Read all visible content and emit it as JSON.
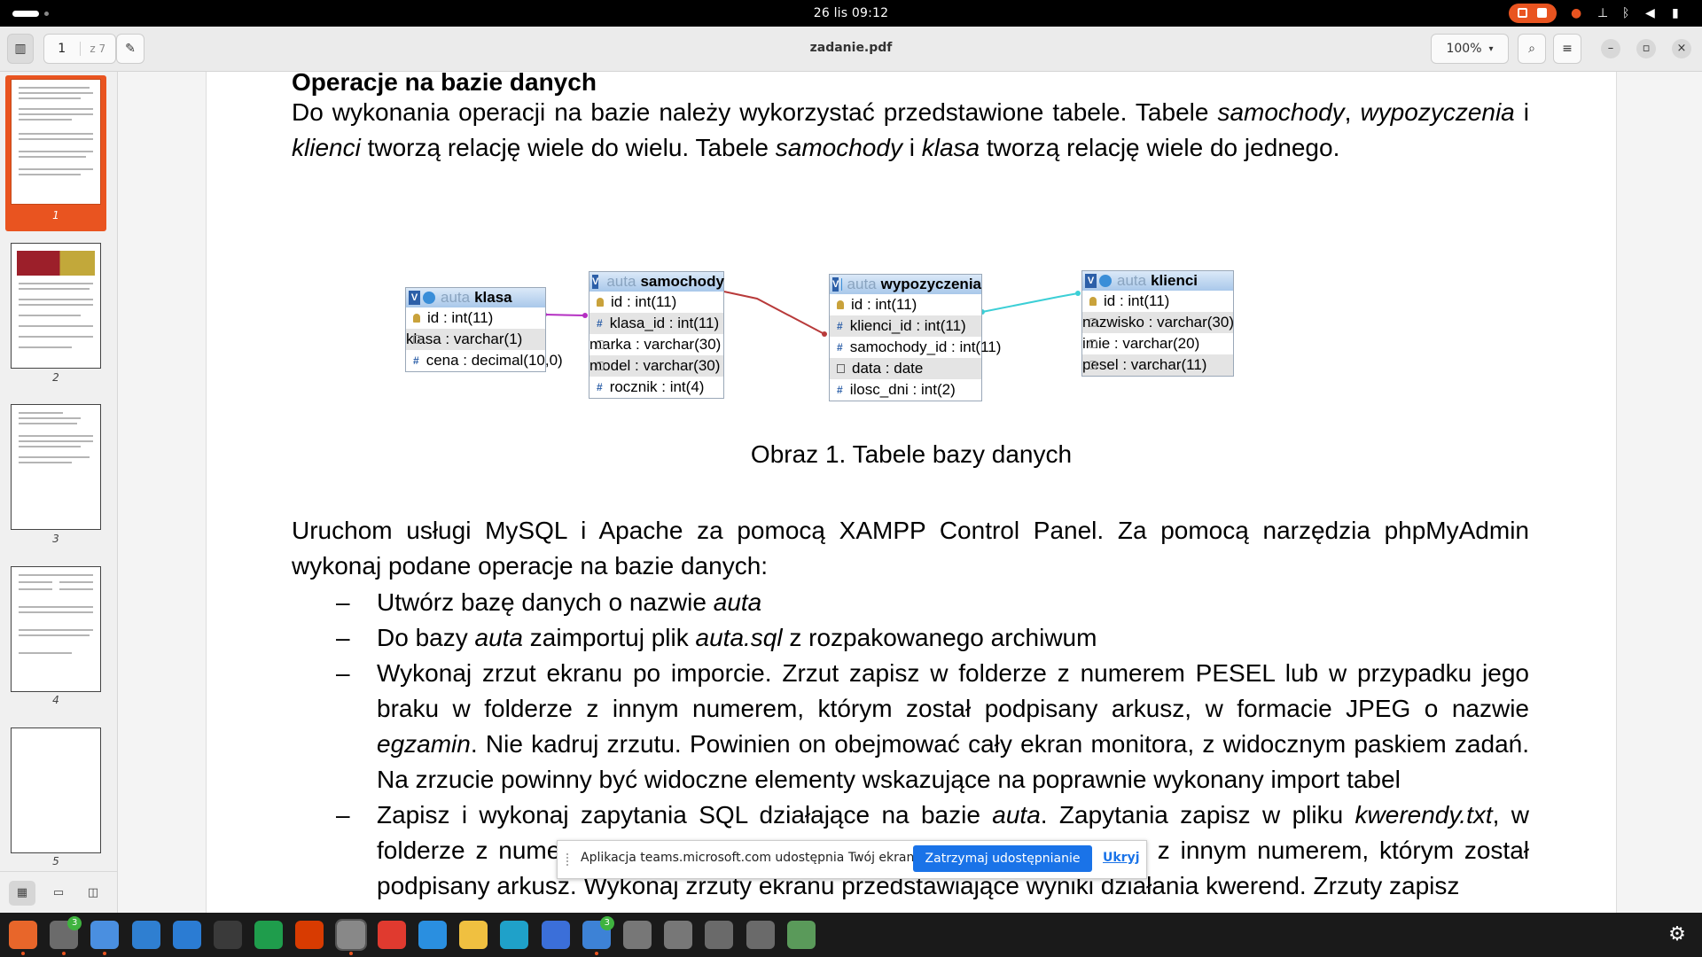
{
  "system": {
    "clock": "26 lis  09:12"
  },
  "viewer": {
    "current_page": "1",
    "total_pages": "z 7",
    "file_name": "zadanie.pdf",
    "zoom": "100%",
    "thumbnails": [
      "1",
      "2",
      "3",
      "4",
      "5"
    ],
    "selected_thumbnail": "1"
  },
  "document": {
    "heading": "Operacje na bazie danych",
    "paragraph1": "Do wykonania operacji na bazie należy wykorzystać przedstawione tabele. Tabele <i>samochody</i>, <i>wypozyczenia</i> i <i>klienci</i> tworzą relację wiele do wielu. Tabele <i>samochody</i> i <i>klasa</i> tworzą relację wiele do jednego.",
    "figure_caption": "Obraz 1. Tabele bazy danych",
    "paragraph2": "Uruchom usługi MySQL i Apache za pomocą XAMPP Control Panel. Za pomocą narzędzia phpMyAdmin wykonaj podane operacje na bazie danych:",
    "bullets": [
      "Utwórz bazę danych o nazwie <i>auta</i>",
      "Do bazy <i>auta</i> zaimportuj plik <i>auta.sql</i> z rozpakowanego archiwum",
      "Wykonaj zrzut ekranu po imporcie. Zrzut zapisz w folderze z numerem PESEL lub w przypadku jego braku w folderze z innym numerem, którym został podpisany arkusz, w formacie JPEG o nazwie <i>egzamin</i>. Nie kadruj zrzutu. Powinien on obejmować cały ekran monitora, z widocznym paskiem zadań. Na zrzucie powinny być widoczne elementy wskazujące na poprawnie wykonany import tabel",
      "Zapisz i wykonaj zapytania SQL działające na bazie <i>auta</i>. Zapytania zapisz w pliku <i>kwerendy.txt</i>, w folderze z numerem PESEL lub w przypadku jego braku w folderze z innym numerem, którym został podpisany arkusz. Wykonaj zrzuty ekranu przedstawiające wyniki działania kwerend. Zrzuty zapisz"
    ],
    "db_tables": [
      {
        "schema": "auta",
        "name": "klasa",
        "fields": [
          {
            "icon": "key",
            "text": "id : int(11)"
          },
          {
            "icon": "text",
            "text": "klasa : varchar(1)"
          },
          {
            "icon": "number",
            "text": "cena : decimal(10,0)"
          }
        ]
      },
      {
        "schema": "auta",
        "name": "samochody",
        "fields": [
          {
            "icon": "key",
            "text": "id : int(11)"
          },
          {
            "icon": "number",
            "text": "klasa_id : int(11)"
          },
          {
            "icon": "text",
            "text": "marka : varchar(30)"
          },
          {
            "icon": "text",
            "text": "model : varchar(30)"
          },
          {
            "icon": "number",
            "text": "rocznik : int(4)"
          }
        ]
      },
      {
        "schema": "auta",
        "name": "wypozyczenia",
        "fields": [
          {
            "icon": "key",
            "text": "id : int(11)"
          },
          {
            "icon": "number",
            "text": "klienci_id : int(11)"
          },
          {
            "icon": "number",
            "text": "samochody_id : int(11)"
          },
          {
            "icon": "date",
            "text": "data : date"
          },
          {
            "icon": "number",
            "text": "ilosc_dni : int(2)"
          }
        ]
      },
      {
        "schema": "auta",
        "name": "klienci",
        "fields": [
          {
            "icon": "key",
            "text": "id : int(11)"
          },
          {
            "icon": "text",
            "text": "nazwisko : varchar(30)"
          },
          {
            "icon": "text",
            "text": "imie : varchar(20)"
          },
          {
            "icon": "text",
            "text": "pesel : varchar(11)"
          }
        ]
      }
    ],
    "relation_colors": {
      "klasa_samochody": "#b42fc2",
      "samochody_wypozyczenia": "#b83a3a",
      "wypozyczenia_klienci": "#3ccfd6"
    }
  },
  "share_notification": {
    "message": "Aplikacja teams.microsoft.com udostępnia Twój ekran.",
    "stop_button": "Zatrzymaj udostępnianie",
    "hide_link": "Ukryj"
  },
  "dock": {
    "apps": [
      {
        "icon": "firefox-icon",
        "color": "#e8662a"
      },
      {
        "icon": "files-icon",
        "color": "#6b6b6b",
        "badge": "3"
      },
      {
        "icon": "chromium-icon",
        "color": "#4a8fe0"
      },
      {
        "icon": "document-icon",
        "color": "#2f7fd1"
      },
      {
        "icon": "word-icon",
        "color": "#2b7cd3"
      },
      {
        "icon": "terminal-icon",
        "color": "#3a3a3a"
      },
      {
        "icon": "spreadsheet-icon",
        "color": "#1f9d4c"
      },
      {
        "icon": "office-icon",
        "color": "#d83b01"
      },
      {
        "icon": "document-viewer-icon",
        "color": "#888888"
      },
      {
        "icon": "wps-icon",
        "color": "#e03a2f"
      },
      {
        "icon": "vscode-icon",
        "color": "#2a8fe0"
      },
      {
        "icon": "text-editor-icon",
        "color": "#f0c040"
      },
      {
        "icon": "edge-icon",
        "color": "#1fa1c9"
      },
      {
        "icon": "notes-icon",
        "color": "#3b6fd9"
      },
      {
        "icon": "teams-icon",
        "color": "#3d82d6",
        "badge": "3"
      },
      {
        "icon": "drive-icon",
        "color": "#777777"
      },
      {
        "icon": "drive-icon",
        "color": "#777777"
      },
      {
        "icon": "ssd-icon",
        "color": "#6a6a6a"
      },
      {
        "icon": "ssd-icon",
        "color": "#6a6a6a"
      },
      {
        "icon": "trash-icon",
        "color": "#5a9a5a"
      }
    ],
    "show_apps": "⚙"
  }
}
